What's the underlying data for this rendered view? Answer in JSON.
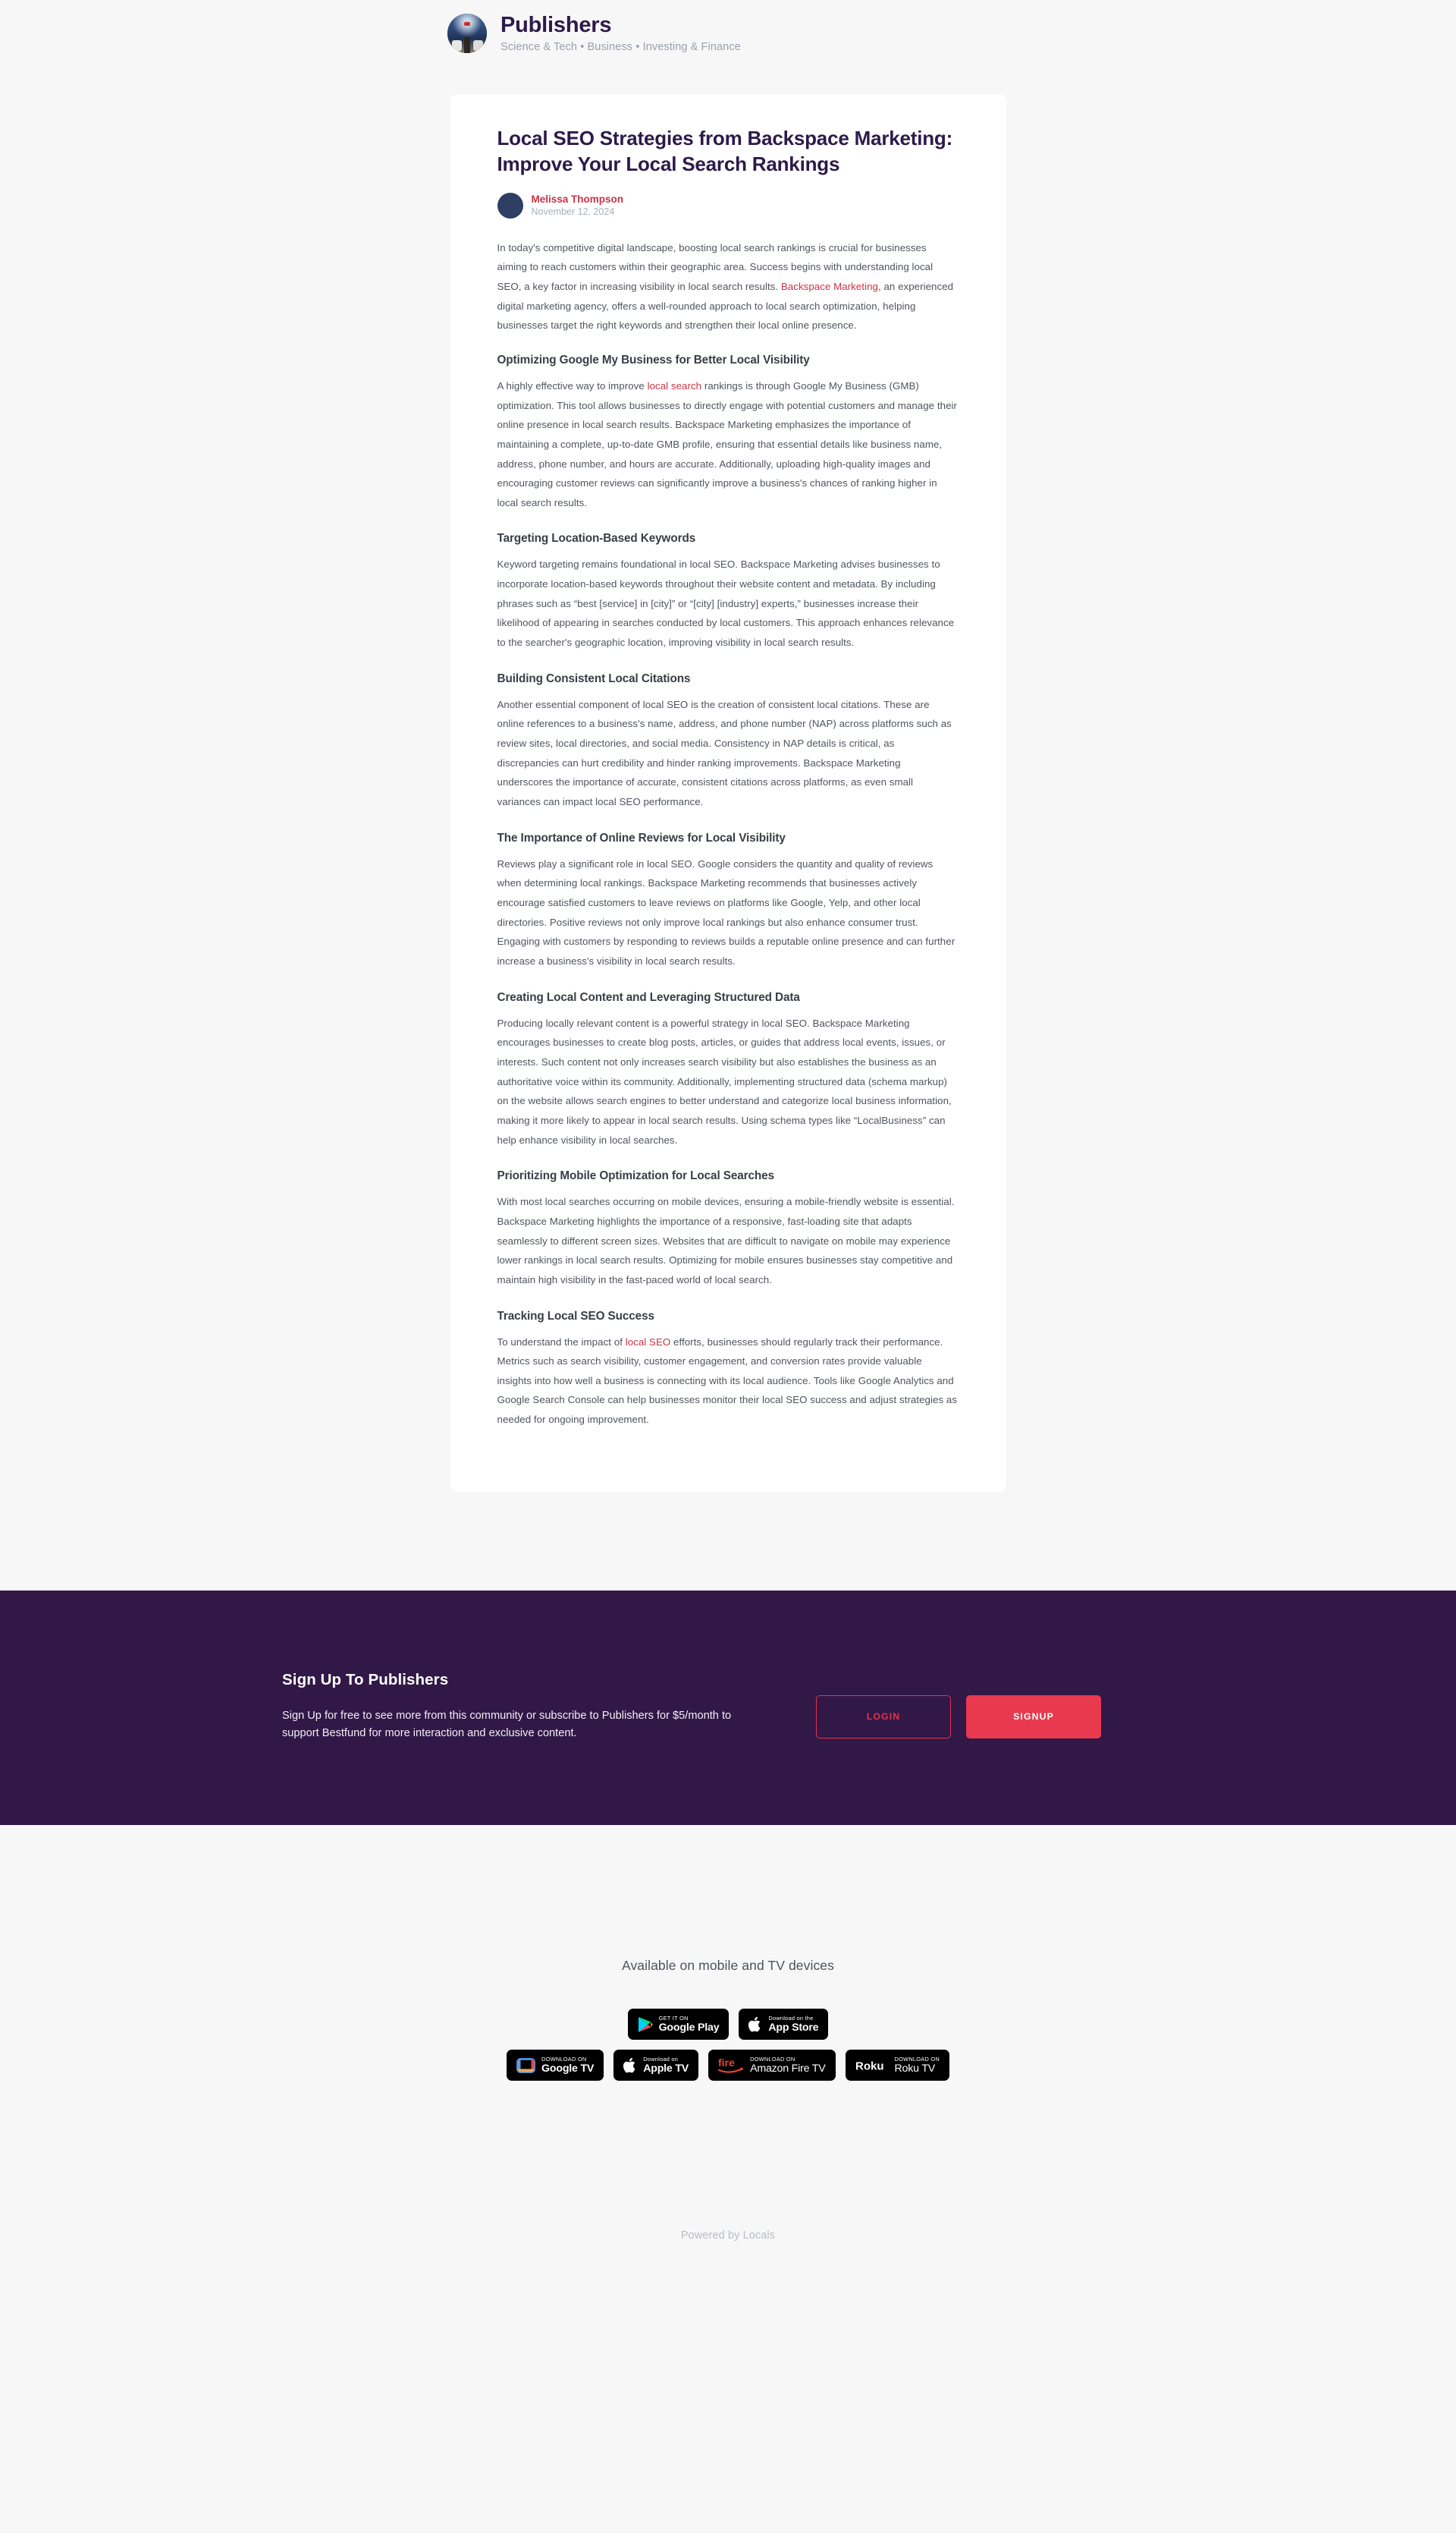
{
  "header": {
    "brand_name": "Publishers",
    "tags": "Science & Tech • Business • Investing & Finance",
    "avatar_name": "publishers-avatar"
  },
  "article": {
    "title": "Local SEO Strategies from Backspace Marketing: Improve Your Local Search Rankings",
    "author": "Melissa Thompson",
    "date": "November 12, 2024",
    "intro": {
      "part1": "In today's competitive digital landscape, boosting local search rankings is crucial for businesses aiming to reach customers within their geographic area. Success begins with understanding local SEO, a key factor in increasing visibility in local search results. ",
      "link": "Backspace Marketing",
      "part2": ", an experienced digital marketing agency, offers a well-rounded approach to local search optimization, helping businesses target the right keywords and strengthen their local online presence."
    },
    "sections": [
      {
        "heading": "Optimizing Google My Business for Better Local Visibility",
        "part1": "A highly effective way to improve ",
        "link": "local search",
        "part2": " rankings is through Google My Business (GMB) optimization. This tool allows businesses to directly engage with potential customers and manage their online presence in local search results. Backspace Marketing emphasizes the importance of maintaining a complete, up-to-date GMB profile, ensuring that essential details like business name, address, phone number, and hours are accurate. Additionally, uploading high-quality images and encouraging customer reviews can significantly improve a business's chances of ranking higher in local search results."
      },
      {
        "heading": "Targeting Location-Based Keywords",
        "part1": "Keyword targeting remains foundational in local SEO. Backspace Marketing advises businesses to incorporate location-based keywords throughout their website content and metadata. By including phrases such as “best [service] in [city]” or “[city] [industry] experts,” businesses increase their likelihood of appearing in searches conducted by local customers. This approach enhances relevance to the searcher's geographic location, improving visibility in local search results.",
        "link": "",
        "part2": ""
      },
      {
        "heading": "Building Consistent Local Citations",
        "part1": "Another essential component of local SEO is the creation of consistent local citations. These are online references to a business's name, address, and phone number (NAP) across platforms such as review sites, local directories, and social media. Consistency in NAP details is critical, as discrepancies can hurt credibility and hinder ranking improvements. Backspace Marketing underscores the importance of accurate, consistent citations across platforms, as even small variances can impact local SEO performance.",
        "link": "",
        "part2": ""
      },
      {
        "heading": "The Importance of Online Reviews for Local Visibility",
        "part1": "Reviews play a significant role in local SEO. Google considers the quantity and quality of reviews when determining local rankings. Backspace Marketing recommends that businesses actively encourage satisfied customers to leave reviews on platforms like Google, Yelp, and other local directories. Positive reviews not only improve local rankings but also enhance consumer trust. Engaging with customers by responding to reviews builds a reputable online presence and can further increase a business's visibility in local search results.",
        "link": "",
        "part2": ""
      },
      {
        "heading": "Creating Local Content and Leveraging Structured Data",
        "part1": "Producing locally relevant content is a powerful strategy in local SEO. Backspace Marketing encourages businesses to create blog posts, articles, or guides that address local events, issues, or interests. Such content not only increases search visibility but also establishes the business as an authoritative voice within its community. Additionally, implementing structured data (schema markup) on the website allows search engines to better understand and categorize local business information, making it more likely to appear in local search results. Using schema types like “LocalBusiness” can help enhance visibility in local searches.",
        "link": "",
        "part2": ""
      },
      {
        "heading": "Prioritizing Mobile Optimization for Local Searches",
        "part1": "With most local searches occurring on mobile devices, ensuring a mobile-friendly website is essential. Backspace Marketing highlights the importance of a responsive, fast-loading site that adapts seamlessly to different screen sizes. Websites that are difficult to navigate on mobile may experience lower rankings in local search results. Optimizing for mobile ensures businesses stay competitive and maintain high visibility in the fast-paced world of local search.",
        "link": "",
        "part2": ""
      },
      {
        "heading": "Tracking Local SEO Success",
        "part1": "To understand the impact of ",
        "link": "local SEO",
        "part2": " efforts, businesses should regularly track their performance. Metrics such as search visibility, customer engagement, and conversion rates provide valuable insights into how well a business is connecting with its local audience. Tools like Google Analytics and Google Search Console can help businesses monitor their local SEO success and adjust strategies as needed for ongoing improvement."
      }
    ]
  },
  "signup": {
    "heading": "Sign Up To Publishers",
    "copy": "Sign Up for free to see more from this community or subscribe to Publishers for $5/month to support Bestfund for more interaction and exclusive content.",
    "login_label": "LOGIN",
    "signup_label": "SIGNUP"
  },
  "devices": {
    "title": "Available on mobile and TV devices",
    "badges_row1": [
      {
        "small": "GET IT ON",
        "big": "Google Play",
        "icon": "google-play-icon"
      },
      {
        "small": "Download on the",
        "big": "App Store",
        "icon": "apple-icon"
      }
    ],
    "badges_row2": [
      {
        "small": "DOWNLOAD ON",
        "big": "Google TV",
        "icon": "google-tv-icon"
      },
      {
        "small": "Download on",
        "big": "Apple TV",
        "icon": "apple-icon"
      },
      {
        "small": "DOWNLOAD ON",
        "big": "Amazon Fire TV",
        "icon": "fire-tv-icon"
      },
      {
        "small": "DOWNLOAD ON",
        "big": "Roku TV",
        "icon": "roku-icon"
      }
    ]
  },
  "footer": {
    "powered_by": "Powered by Locals"
  },
  "colors": {
    "page_bg": "#f7f7f7",
    "card_bg": "#ffffff",
    "brand_purple": "#2d1a4a",
    "band_purple": "#311847",
    "accent_red": "#cc3344",
    "signup_red": "#e8394e",
    "body_text": "#50545c",
    "muted": "#9aa0ab"
  }
}
